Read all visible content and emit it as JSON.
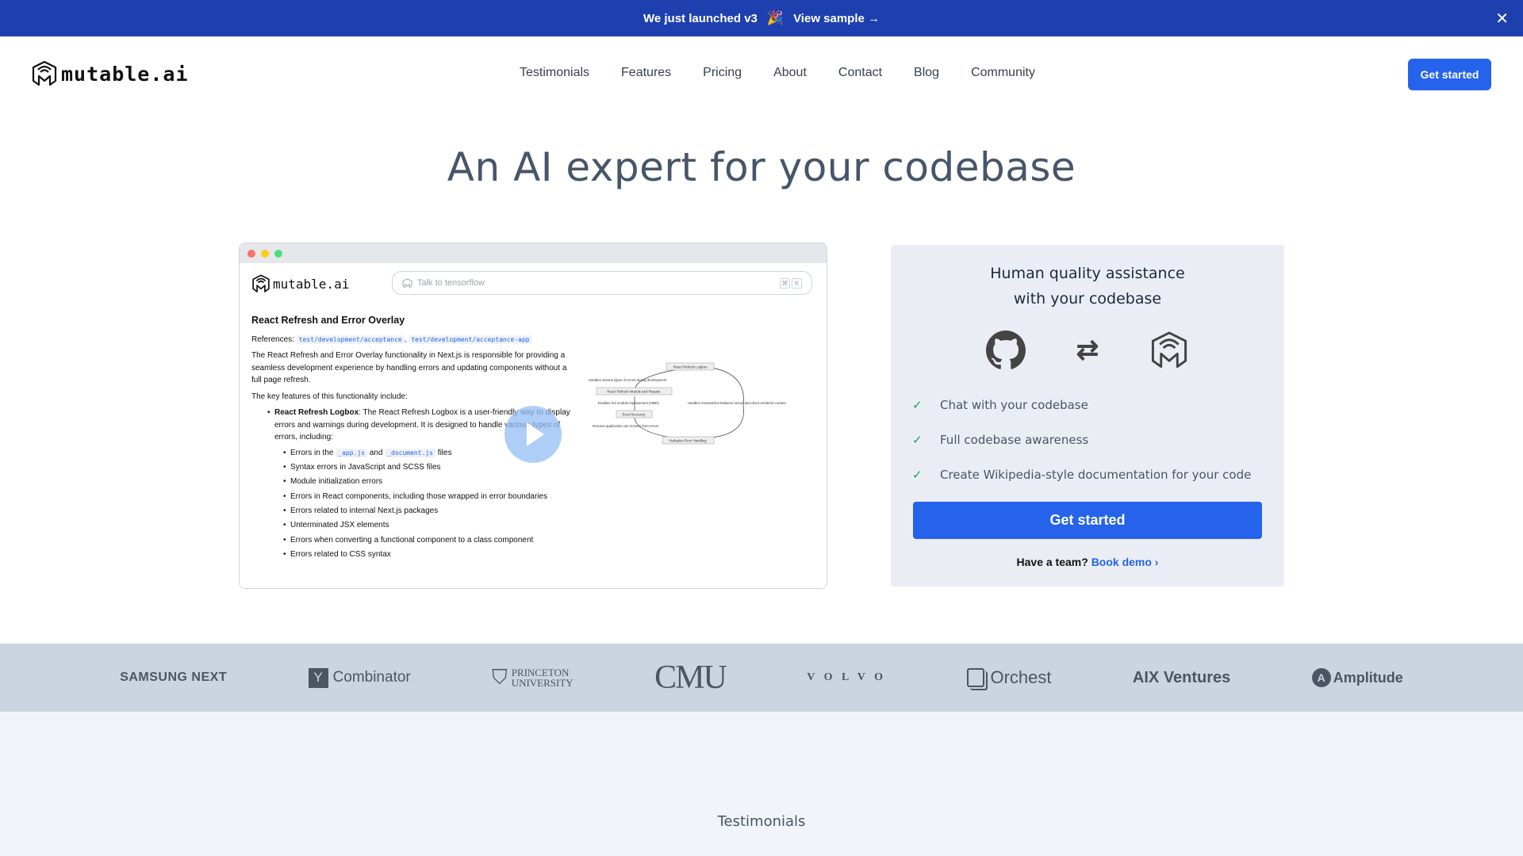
{
  "banner": {
    "text": "We just launched v3",
    "party_emoji": "🎉",
    "link": "View sample →",
    "close": "✕"
  },
  "nav": {
    "brand": "mutable.ai",
    "links": [
      "Testimonials",
      "Features",
      "Pricing",
      "About",
      "Contact",
      "Blog",
      "Community"
    ],
    "cta": "Get started"
  },
  "hero": {
    "title": "An AI expert for your codebase"
  },
  "mock_window": {
    "brand": "mutable.ai",
    "search_placeholder": "Talk to tensorflow",
    "shortcut_keys": [
      "⌘",
      "K"
    ],
    "doc": {
      "title": "React Refresh and Error Overlay",
      "references_label": "References:",
      "references": [
        "test/development/acceptance",
        "test/development/acceptance-app"
      ],
      "intro": "The React Refresh and Error Overlay functionality in Next.js is responsible for providing a seamless development experience by handling errors and updating components without a full page refresh.",
      "features_intro": "The key features of this functionality include:",
      "feature_title": "React Refresh Logbox",
      "feature_desc": ": The React Refresh Logbox is a user-friendly way to display errors and warnings during development. It is designed to handle various types of errors, including:",
      "errors_prefix": "Errors in the",
      "errors_code1": "_app.js",
      "errors_and": "and",
      "errors_code2": "_document.js",
      "errors_suffix": "files",
      "sub_items": [
        "Syntax errors in JavaScript and SCSS files",
        "Module initialization errors",
        "Errors in React components, including those wrapped in error boundaries",
        "Errors related to internal Next.js packages",
        "Unterminated JSX elements",
        "Errors when converting a functional component to a class component",
        "Errors related to CSS syntax"
      ]
    },
    "diagram": {
      "nodes": [
        "React Refresh Logbox",
        "React Refresh Module and Require",
        "Error Recovery",
        "Hydration Error Handling"
      ],
      "edges": [
        "Handles various types of errors during development",
        "Enables hot module replacement (HMR)",
        "Ensures application can recover from errors",
        "Handles mismatches between server and client rendered content"
      ]
    }
  },
  "card": {
    "title_line1": "Human quality assistance",
    "title_line2": "with your codebase",
    "features": [
      "Chat with your codebase",
      "Full codebase awareness",
      "Create Wikipedia-style documentation for your code"
    ],
    "cta": "Get started",
    "team_text": "Have a team?",
    "team_link": "Book demo ›"
  },
  "logos": [
    "SAMSUNG NEXT",
    "Combinator",
    "PRINCETON",
    "UNIVERSITY",
    "CMU",
    "V O L V O",
    "Orchest",
    "AIX Ventures",
    "Amplitude"
  ],
  "section": {
    "testimonials": "Testimonials"
  },
  "colors": {
    "banner": "#1e40af",
    "primary": "#2563eb",
    "check": "#22a05a",
    "logo_strip": "#cbd5e1",
    "card_bg": "#eaeef4"
  }
}
